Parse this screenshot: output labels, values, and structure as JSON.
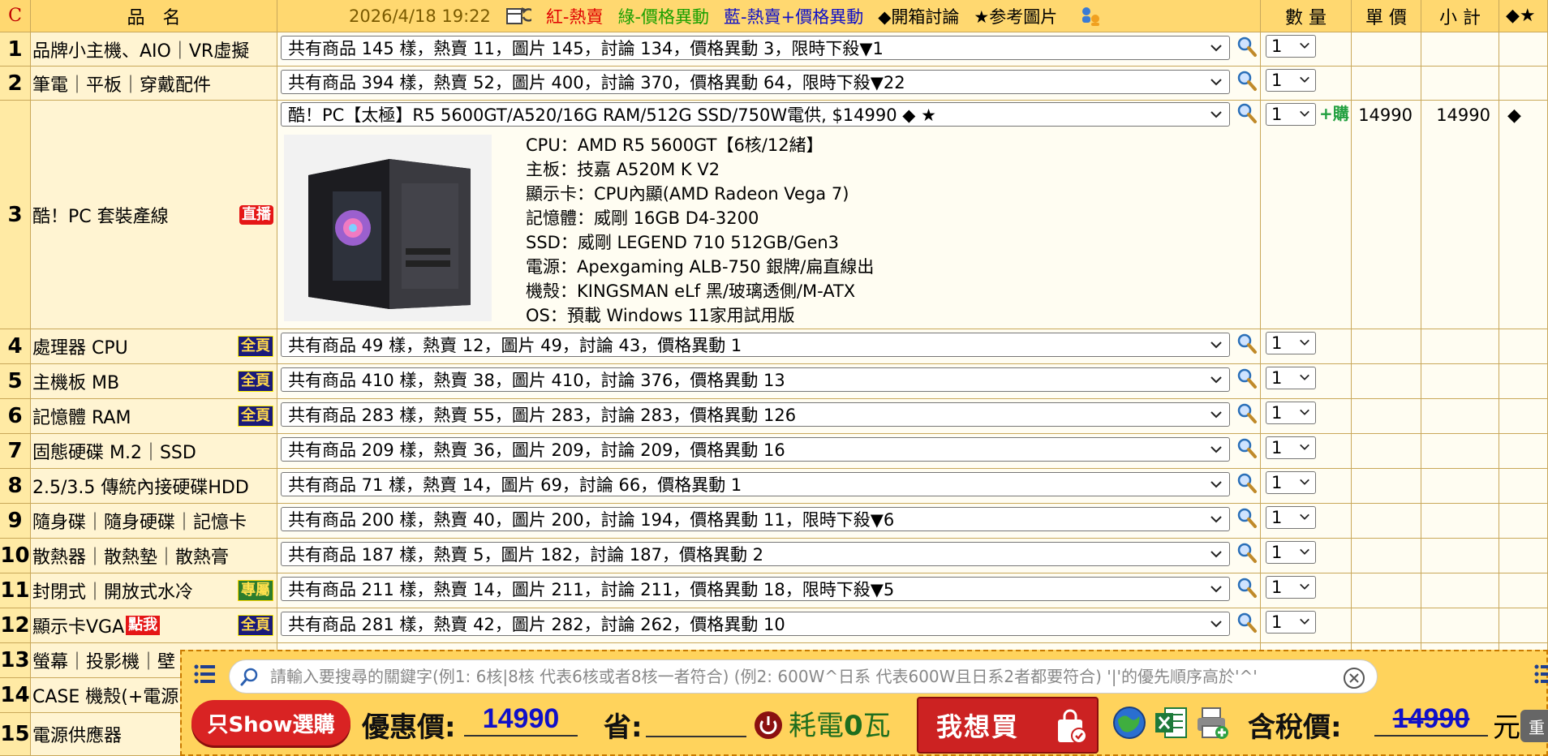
{
  "header": {
    "c_label": "C",
    "name_label": "品　名",
    "datetime": "2026/4/18 19:22",
    "legend_red": "紅-熱賣",
    "legend_green": "綠-價格異動",
    "legend_blue": "藍-熱賣+價格異動",
    "legend_unbox": "◆開箱討論",
    "legend_pic": "★参考圖片",
    "qty_label": "數 量",
    "price_label": "單 價",
    "subtotal_label": "小 計",
    "mark_label": "◆★"
  },
  "rows": [
    {
      "no": "1",
      "name": "品牌小主機、AIO｜VR虛擬",
      "badge": "",
      "selected": "共有商品 145 樣，熱賣 11，圖片 145，討論 134，價格異動 3，限時下殺▼1",
      "qty": "1"
    },
    {
      "no": "2",
      "name": "筆電｜平板｜穿戴配件",
      "badge": "",
      "selected": "共有商品 394 樣，熱賣 52，圖片 400，討論 370，價格異動 64，限時下殺▼22",
      "qty": "1"
    },
    {
      "no": "3",
      "name": "酷！PC 套裝產線",
      "badge": "直播",
      "selected": "酷！PC【太極】R5 5600GT/A520/16G RAM/512G SSD/750W電供, $14990 ◆ ★",
      "qty": "1",
      "buy": "購",
      "price": "14990",
      "subtotal": "14990",
      "mark": "◆"
    },
    {
      "no": "4",
      "name": "處理器 CPU",
      "badge": "全頁",
      "selected": "共有商品 49 樣，熱賣 12，圖片 49，討論 43，價格異動 1",
      "qty": "1"
    },
    {
      "no": "5",
      "name": "主機板 MB",
      "badge": "全頁",
      "selected": "共有商品 410 樣，熱賣 38，圖片 410，討論 376，價格異動 13",
      "qty": "1"
    },
    {
      "no": "6",
      "name": "記憶體 RAM",
      "badge": "全頁",
      "selected": "共有商品 283 樣，熱賣 55，圖片 283，討論 283，價格異動 126",
      "qty": "1"
    },
    {
      "no": "7",
      "name": "固態硬碟 M.2｜SSD",
      "badge": "",
      "selected": "共有商品 209 樣，熱賣 36，圖片 209，討論 209，價格異動 16",
      "qty": "1"
    },
    {
      "no": "8",
      "name": "2.5/3.5 傳統內接硬碟HDD",
      "badge": "",
      "selected": "共有商品 71 樣，熱賣 14，圖片 69，討論 66，價格異動 1",
      "qty": "1"
    },
    {
      "no": "9",
      "name": "隨身碟｜隨身硬碟｜記憶卡",
      "badge": "",
      "selected": "共有商品 200 樣，熱賣 40，圖片 200，討論 194，價格異動 11，限時下殺▼6",
      "qty": "1"
    },
    {
      "no": "10",
      "name": "散熱器｜散熱墊｜散熱膏",
      "badge": "",
      "selected": "共有商品 187 樣，熱賣 5，圖片 182，討論 187，價格異動 2",
      "qty": "1"
    },
    {
      "no": "11",
      "name": "封閉式｜開放式水冷",
      "badge": "專屬",
      "selected": "共有商品 211 樣，熱賣 14，圖片 211，討論 211，價格異動 18，限時下殺▼5",
      "qty": "1"
    },
    {
      "no": "12",
      "name": "顯示卡VGA",
      "badge": "全頁",
      "badge2": "點我",
      "selected": "共有商品 281 樣，熱賣 42，圖片 282，討論 262，價格異動 10",
      "qty": "1"
    },
    {
      "no": "13",
      "name": "螢幕｜投影機｜壁",
      "badge": "",
      "selected": "",
      "qty": ""
    },
    {
      "no": "14",
      "name": "CASE 機殼(+電源",
      "badge": "",
      "selected": "",
      "qty": ""
    },
    {
      "no": "15",
      "name": "電源供應器",
      "badge": "",
      "selected": "",
      "qty": ""
    }
  ],
  "specs": [
    "CPU：AMD R5 5600GT【6核/12緒】",
    "主板：技嘉 A520M K V2",
    "顯示卡：CPU內顯(AMD Radeon Vega 7)",
    "記憶體：威剛 16GB D4-3200",
    "SSD：威剛 LEGEND 710 512GB/Gen3",
    "電源：Apexgaming ALB-750 銀牌/扁直線出",
    "機殼：KINGSMAN eLf 黑/玻璃透側/M-ATX",
    "OS：預載 Windows 11家用試用版"
  ],
  "bottom": {
    "search_placeholder": "請輸入要搜尋的關鍵字(例1: 6核|8核 代表6核或者8核一者符合) (例2: 600W^日系 代表600W且日系2者都要符合) '|'的優先順序高於'^'",
    "show_selected": "只Show選購",
    "discount_label": "優惠價:",
    "discount_value": "14990",
    "save_label": "省:",
    "save_value": "",
    "power_label": "耗電",
    "power_value": "0",
    "power_unit": "瓦",
    "want_buy": "我想買",
    "tax_label": "含稅價:",
    "tax_value": "14990",
    "yuan": "元",
    "heavy": "重"
  },
  "colors": {
    "header_bg": "#ffd870",
    "bar_bg": "#ffd35c",
    "price_blue": "#1010c8",
    "accent_red": "#cc2222"
  }
}
